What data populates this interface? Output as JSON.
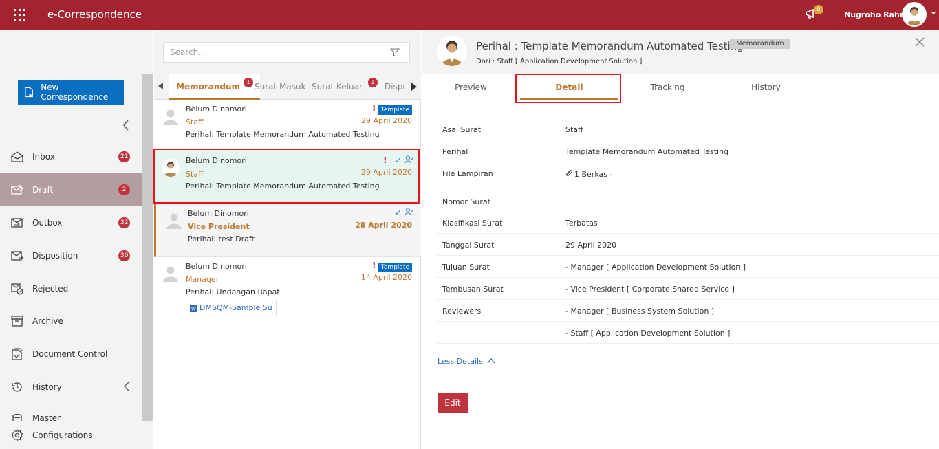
{
  "app": {
    "title": "e-Correspondence",
    "notification_count": "0",
    "user_name": "Nugroho Rahm"
  },
  "sidebar": {
    "new_button": "New Correspondence",
    "items": [
      {
        "label": "Inbox",
        "badge": "21",
        "icon": "inbox-icon"
      },
      {
        "label": "Draft",
        "badge": "2",
        "icon": "draft-icon"
      },
      {
        "label": "Outbox",
        "badge": "32",
        "icon": "outbox-icon"
      },
      {
        "label": "Disposition",
        "badge": "30",
        "icon": "disposition-icon"
      },
      {
        "label": "Rejected",
        "icon": "rejected-icon"
      },
      {
        "label": "Archive",
        "icon": "archive-icon"
      },
      {
        "label": "Document Control",
        "icon": "document-control-icon"
      },
      {
        "label": "History",
        "icon": "history-icon"
      },
      {
        "label": "Master",
        "icon": "master-icon"
      }
    ],
    "configurations": "Configurations"
  },
  "list": {
    "search_placeholder": "Search..",
    "tabs": [
      {
        "label": "Memorandum",
        "badge": "1"
      },
      {
        "label": "Surat Masuk"
      },
      {
        "label": "Surat Keluar",
        "badge": "1"
      },
      {
        "label": "Dispo"
      }
    ],
    "items": [
      {
        "status": "Belum Dinomori",
        "role": "Staff",
        "subject": "Perihal: Template Memorandum Automated Testing",
        "date": "29 April 2020",
        "tag": "Template"
      },
      {
        "status": "Belum Dinomori",
        "role": "Staff",
        "subject": "Perihal: Template Memorandum Automated Testing",
        "date": "29 April 2020"
      },
      {
        "status": "Belum Dinomori",
        "role": "Vice President",
        "subject": "Perihal: test Draft",
        "date": "28 April 2020"
      },
      {
        "status": "Belum Dinomori",
        "role": "Manager",
        "subject": "Perihal: Undangan Rapat",
        "date": "14 April 2020",
        "tag": "Template",
        "attachment": "DMSQM-Sample Su"
      }
    ]
  },
  "detail": {
    "title": "Perihal : Template Memorandum Automated Testing",
    "type_chip": "Memorandum",
    "from": "Dari : Staff [ Application Development Solution ]",
    "tabs": [
      "Preview",
      "Detail",
      "Tracking",
      "History"
    ],
    "fields": [
      {
        "label": "Asal Surat",
        "value": "Staff"
      },
      {
        "label": "Perihal",
        "value": "Template Memorandum Automated Testing"
      },
      {
        "label": "File Lampiran",
        "value": "1 Berkas -"
      },
      {
        "label": "Nomor Surat",
        "value": ""
      },
      {
        "label": "Klasifikasi Surat",
        "value": "Terbatas"
      },
      {
        "label": "Tanggal Surat",
        "value": "29 April 2020"
      },
      {
        "label": "Tujuan Surat",
        "value": "- Manager [ Application Development Solution ]"
      },
      {
        "label": "Tembusan Surat",
        "value": "- Vice President [ Corporate Shared Service ]"
      },
      {
        "label": "Reviewers",
        "value": "- Manager [ Business System Solution ]"
      },
      {
        "label": "",
        "value": "- Staff [ Application Development Solution ]"
      }
    ],
    "less_details": "Less Details",
    "edit_button": "Edit"
  },
  "colors": {
    "brand": "#a3232f",
    "accent": "#c0772e",
    "primary_button": "#0b6fc1",
    "badge": "#c0343f",
    "highlight_box": "#e0141d"
  }
}
